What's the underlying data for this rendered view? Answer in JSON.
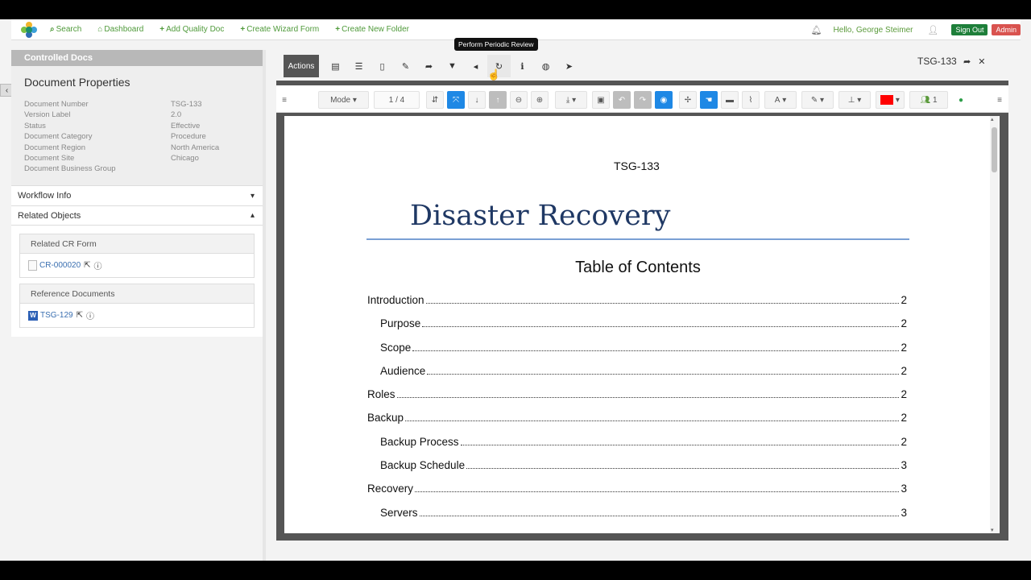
{
  "nav": {
    "links": [
      {
        "icon": "search-icon",
        "glyph": "⌕",
        "label": "Search"
      },
      {
        "icon": "home-icon",
        "glyph": "⌂",
        "label": "Dashboard"
      },
      {
        "icon": "plus-icon",
        "glyph": "+",
        "label": "Add Quality Doc"
      },
      {
        "icon": "plus-icon",
        "glyph": "+",
        "label": "Create Wizard Form"
      },
      {
        "icon": "plus-icon",
        "glyph": "+",
        "label": "Create New Folder"
      }
    ],
    "greeting": "Hello, George Steimer",
    "signout": "Sign Out",
    "admin": "Admin"
  },
  "left": {
    "header": "Controlled Docs",
    "props_title": "Document Properties",
    "props": [
      {
        "key": "Document Number",
        "value": "TSG-133"
      },
      {
        "key": "Version Label",
        "value": "2.0"
      },
      {
        "key": "Status",
        "value": "Effective"
      },
      {
        "key": "Document Category",
        "value": "Procedure"
      },
      {
        "key": "Document Region",
        "value": "North America"
      },
      {
        "key": "Document Site",
        "value": "Chicago"
      },
      {
        "key": "Document Business Group",
        "value": ""
      }
    ],
    "workflow": "Workflow Info",
    "related": "Related Objects",
    "cr_header": "Related CR Form",
    "cr_link": "CR-000020",
    "ref_header": "Reference Documents",
    "ref_link": "TSG-129"
  },
  "actions": {
    "label": "Actions",
    "tooltip": "Perform Periodic Review",
    "doc_code": "TSG-133"
  },
  "toolbar": {
    "mode": "Mode",
    "page_current": "1",
    "page_sep": "/",
    "page_total": "4",
    "users_count": "1"
  },
  "document": {
    "header_code": "TSG-133",
    "title": "Disaster Recovery",
    "toc_heading": "Table of Contents",
    "toc": [
      {
        "text": "Introduction",
        "page": "2",
        "level": 1
      },
      {
        "text": "Purpose",
        "page": "2",
        "level": 2
      },
      {
        "text": "Scope",
        "page": "2",
        "level": 2
      },
      {
        "text": "Audience",
        "page": "2",
        "level": 2
      },
      {
        "text": "Roles",
        "page": "2",
        "level": 1
      },
      {
        "text": "Backup",
        "page": "2",
        "level": 1
      },
      {
        "text": "Backup Process",
        "page": "2",
        "level": 2
      },
      {
        "text": "Backup Schedule",
        "page": "3",
        "level": 2
      },
      {
        "text": "Recovery",
        "page": "3",
        "level": 1
      },
      {
        "text": "Servers",
        "page": "3",
        "level": 2
      }
    ]
  },
  "colors": {
    "nav_green": "#4f9a3a",
    "signout": "#1e7f3a",
    "admin": "#d9534f",
    "toolbar_blue": "#1e88e5",
    "title_blue": "#1f3864",
    "color_swatch": "#ff0000"
  }
}
